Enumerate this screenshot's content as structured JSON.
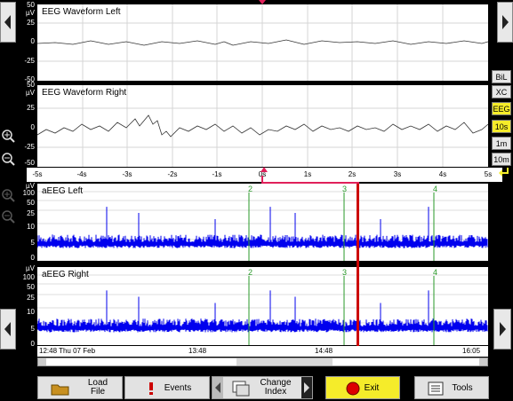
{
  "panels": {
    "eeg_left": {
      "title": "EEG Waveform Left",
      "yunit": "µV",
      "yticks": [
        "50",
        "25",
        "0",
        "-25",
        "-50"
      ]
    },
    "eeg_right": {
      "title": "EEG Waveform Right",
      "yunit": "µV",
      "yticks": [
        "50",
        "25",
        "0",
        "-25",
        "-50"
      ]
    },
    "aeeg_left": {
      "title": "aEEG Left",
      "yunit": "µV",
      "yticks": [
        "100",
        "50",
        "25",
        "10",
        "5",
        "0"
      ]
    },
    "aeeg_right": {
      "title": "aEEG Right",
      "yunit": "µV",
      "yticks": [
        "100",
        "50",
        "25",
        "10",
        "5",
        "0"
      ]
    }
  },
  "eeg_time_axis": [
    "-5s",
    "-4s",
    "-3s",
    "-2s",
    "-1s",
    "0s",
    "1s",
    "2s",
    "3s",
    "4s",
    "5s"
  ],
  "markers": [
    "2",
    "3",
    "4"
  ],
  "aeeg_time_axis": [
    "12:48 Thu 07 Feb",
    "13:48",
    "14:48",
    "16:05"
  ],
  "side_buttons": {
    "bil": "BiL",
    "xc": "XC",
    "eeg": "EEG",
    "ten_s": "10s",
    "one_m": "1m",
    "ten_m": "10m"
  },
  "toolbar": {
    "load_file": "Load\nFile",
    "events": "Events",
    "change_index": "Change\nIndex",
    "exit": "Exit",
    "tools": "Tools"
  },
  "colors": {
    "accent_yellow": "#f5ec2a",
    "aeeg_trace": "#0000ee",
    "cursor": "#cc0000",
    "marker": "#2a9a2a"
  }
}
